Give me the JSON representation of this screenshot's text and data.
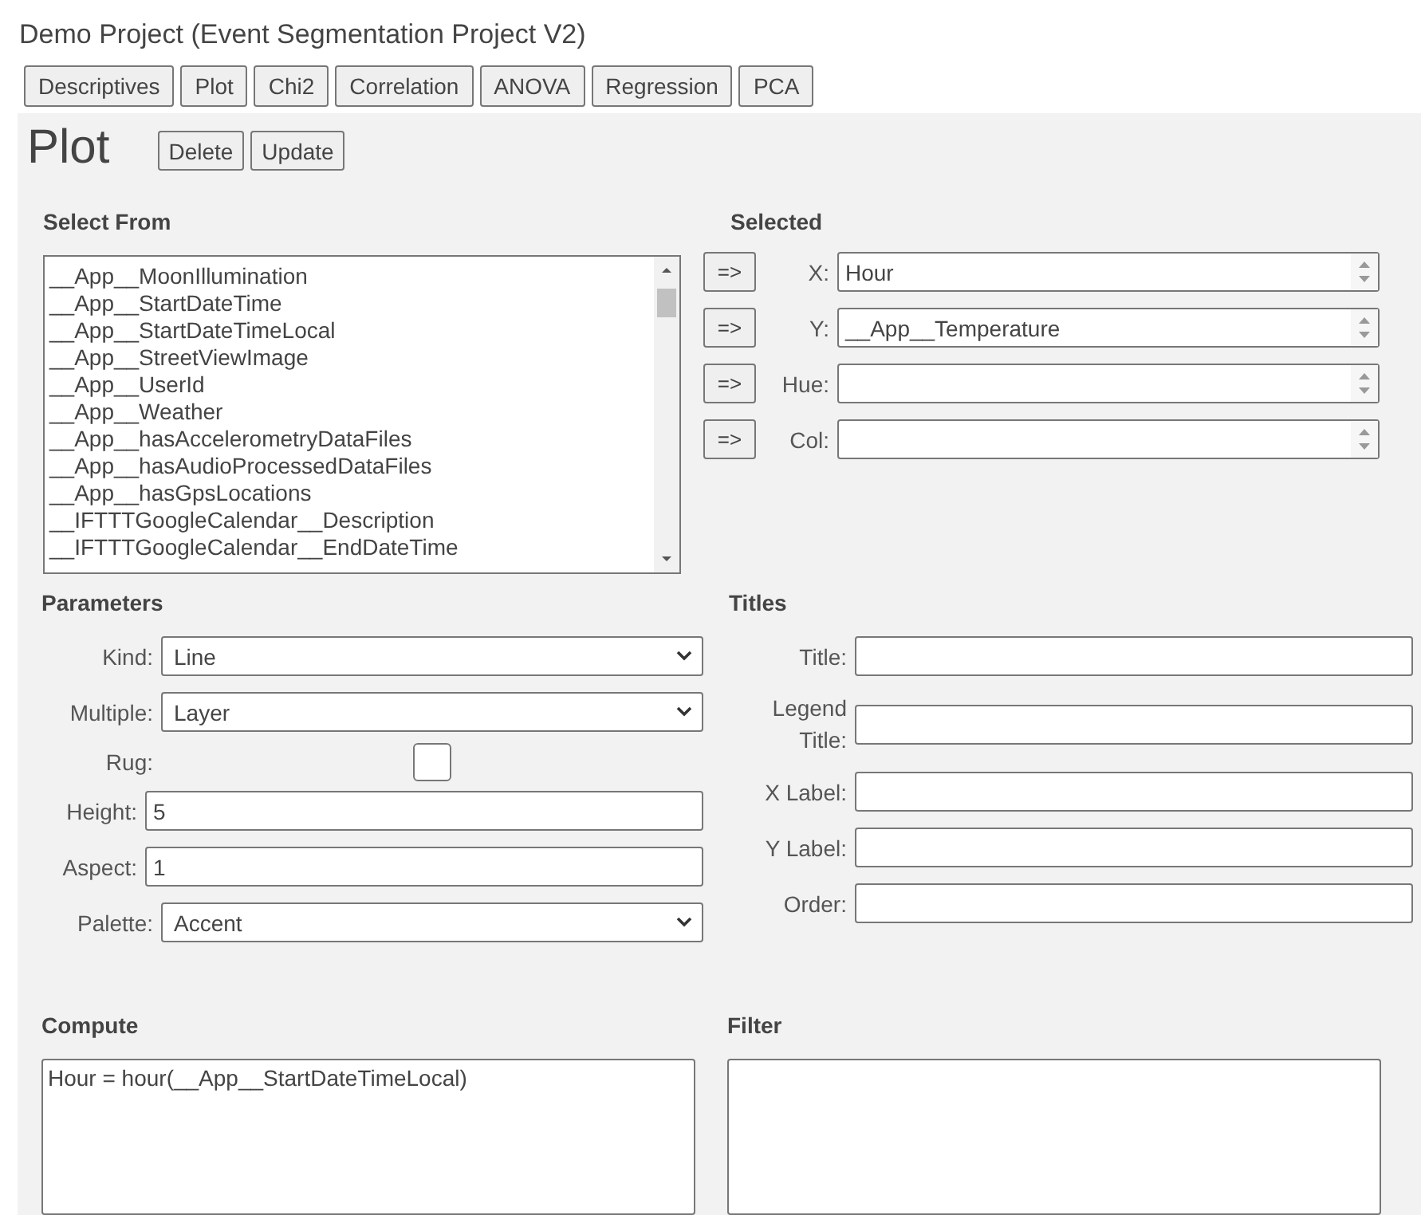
{
  "project_title": "Demo Project (Event Segmentation Project V2)",
  "tabs": [
    {
      "label": "Descriptives"
    },
    {
      "label": "Plot"
    },
    {
      "label": "Chi2"
    },
    {
      "label": "Correlation"
    },
    {
      "label": "ANOVA"
    },
    {
      "label": "Regression"
    },
    {
      "label": "PCA"
    }
  ],
  "heading": "Plot",
  "actions": [
    "Delete",
    "Update"
  ],
  "select_from": {
    "label": "Select From",
    "items": [
      "__App__MoonIllumination",
      "__App__StartDateTime",
      "__App__StartDateTimeLocal",
      "__App__StreetViewImage",
      "__App__UserId",
      "__App__Weather",
      "__App__hasAccelerometryDataFiles",
      "__App__hasAudioProcessedDataFiles",
      "__App__hasGpsLocations",
      "__IFTTTGoogleCalendar__Description",
      "__IFTTTGoogleCalendar__EndDateTime"
    ]
  },
  "selected": {
    "label": "Selected",
    "rows": [
      {
        "button": "=>",
        "label": "X:",
        "value": "Hour"
      },
      {
        "button": "=>",
        "label": "Y:",
        "value": "__App__Temperature"
      },
      {
        "button": "=>",
        "label": "Hue:"
      },
      {
        "button": "=>",
        "label": "Col:"
      }
    ]
  },
  "parameters": {
    "label": "Parameters",
    "fields": [
      {
        "kind": "select",
        "label": "Kind:",
        "value": "Line"
      },
      {
        "kind": "select",
        "label": "Multiple:",
        "value": "Layer"
      },
      {
        "kind": "checkbox",
        "label": "Rug:",
        "checked": false
      },
      {
        "kind": "text",
        "label": "Height:",
        "value": "5"
      },
      {
        "kind": "text",
        "label": "Aspect:",
        "value": "1"
      },
      {
        "kind": "select",
        "label": "Palette:",
        "value": "Accent"
      }
    ]
  },
  "titles": {
    "label": "Titles",
    "fields": [
      {
        "label": "Title:"
      },
      {
        "label": "Legend Title:"
      },
      {
        "label": "X Label:"
      },
      {
        "label": "Y Label:"
      },
      {
        "label": "Order:"
      }
    ]
  },
  "compute": {
    "label": "Compute",
    "value": "Hour = hour(__App__StartDateTimeLocal)"
  },
  "filter": {
    "label": "Filter"
  }
}
